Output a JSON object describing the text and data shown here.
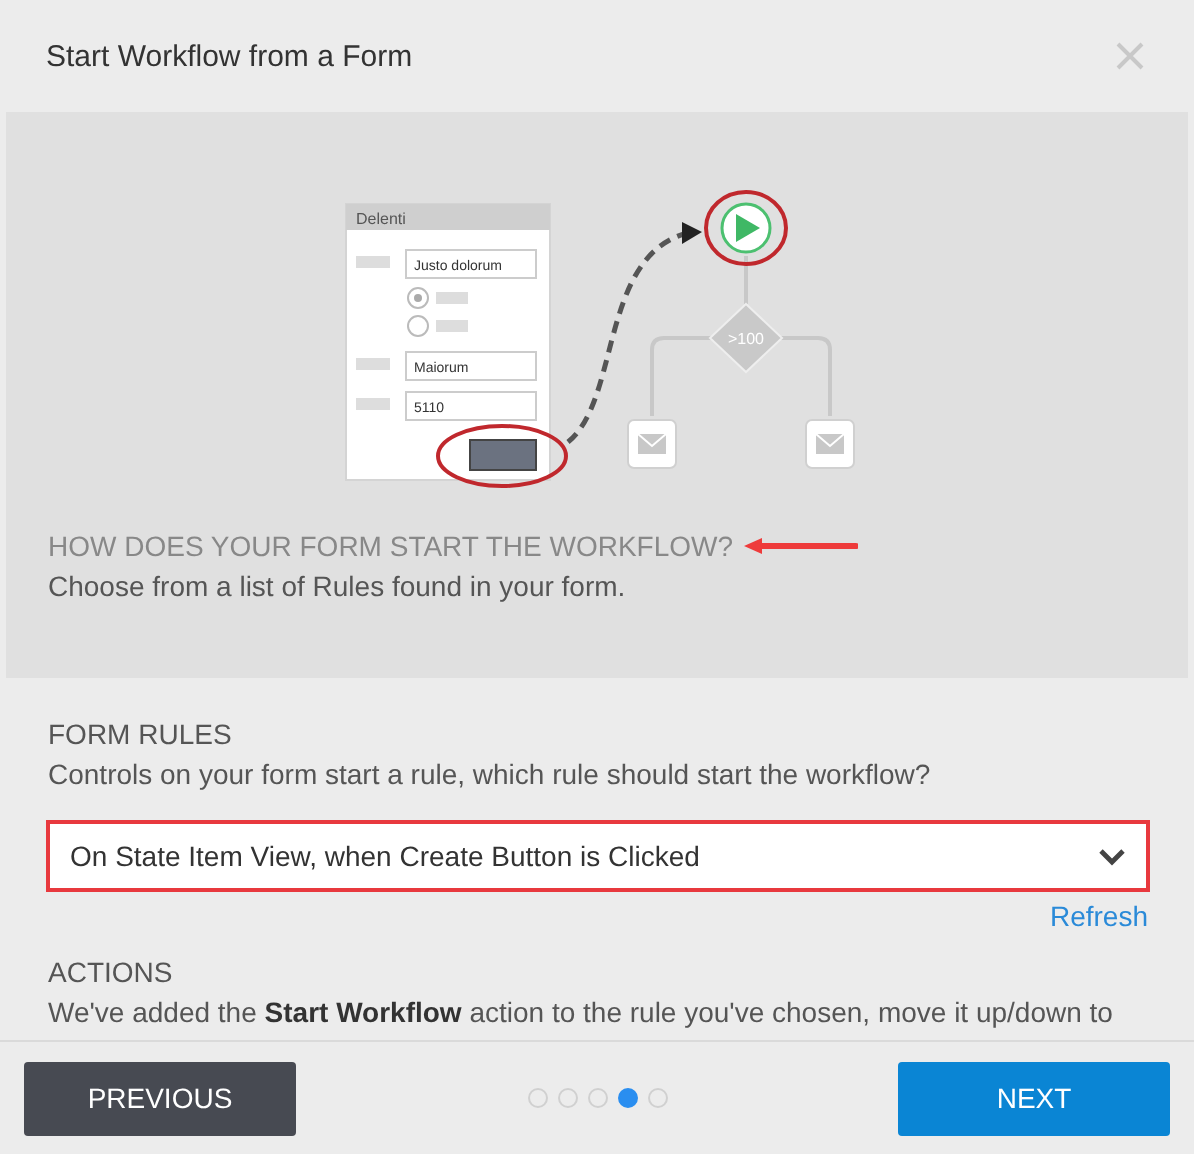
{
  "window": {
    "title": "Start Workflow from a Form"
  },
  "illustration": {
    "form_title": "Delenti",
    "fields": [
      "Justo dolorum",
      "Maiorum",
      "5110"
    ],
    "condition": ">100"
  },
  "intro": {
    "heading": "HOW DOES YOUR FORM START THE WORKFLOW?",
    "text": "Choose from a list of Rules found in your form."
  },
  "form_rules": {
    "heading": "FORM RULES",
    "text": "Controls on your form start a rule, which rule should start the workflow?",
    "dropdown": {
      "value": "On State Item View, when Create Button is Clicked"
    },
    "link": "Refresh"
  },
  "actions": {
    "heading": "ACTIONS",
    "text": "We've added the **Start Workflow** action to the rule you've chosen, move it up/down to"
  },
  "footer": {
    "previous": "PREVIOUS",
    "next": "NEXT",
    "steps": [
      {
        "selected": false
      },
      {
        "selected": false
      },
      {
        "selected": false
      },
      {
        "selected": true
      },
      {
        "selected": false
      }
    ]
  }
}
